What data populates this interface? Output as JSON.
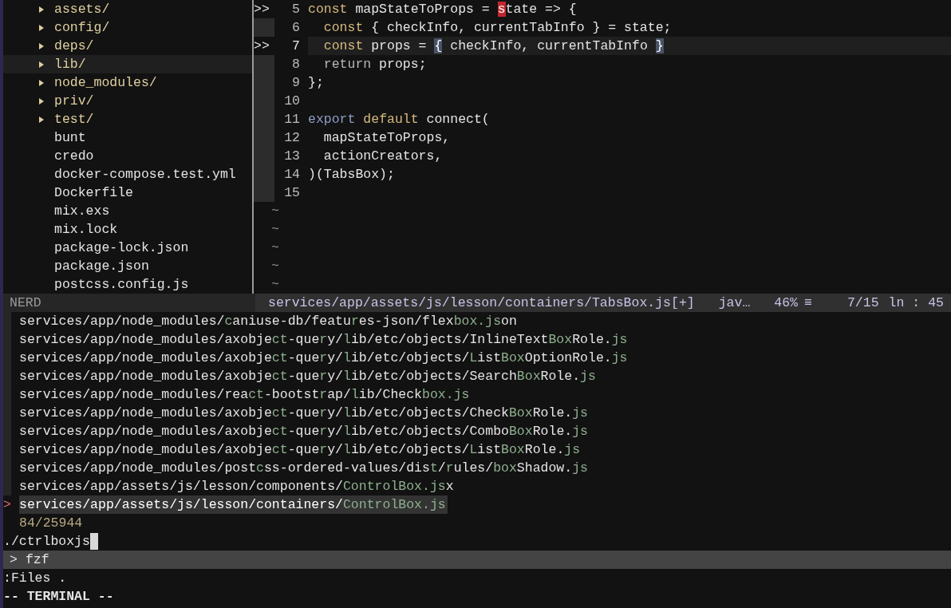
{
  "tree": {
    "items": [
      {
        "name": "assets/",
        "kind": "dir",
        "selected": false
      },
      {
        "name": "config/",
        "kind": "dir",
        "selected": false
      },
      {
        "name": "deps/",
        "kind": "dir",
        "selected": false
      },
      {
        "name": "lib/",
        "kind": "dir",
        "selected": true
      },
      {
        "name": "node_modules/",
        "kind": "dir",
        "selected": false
      },
      {
        "name": "priv/",
        "kind": "dir",
        "selected": false
      },
      {
        "name": "test/",
        "kind": "dir",
        "selected": false
      },
      {
        "name": "bunt",
        "kind": "file",
        "selected": false
      },
      {
        "name": "credo",
        "kind": "file",
        "selected": false
      },
      {
        "name": "docker-compose.test.yml",
        "kind": "file",
        "selected": false
      },
      {
        "name": "Dockerfile",
        "kind": "file",
        "selected": false
      },
      {
        "name": "mix.exs",
        "kind": "file",
        "selected": false
      },
      {
        "name": "mix.lock",
        "kind": "file",
        "selected": false
      },
      {
        "name": "package-lock.json",
        "kind": "file",
        "selected": false
      },
      {
        "name": "package.json",
        "kind": "file",
        "selected": false
      },
      {
        "name": "postcss.config.js",
        "kind": "file",
        "selected": false
      }
    ]
  },
  "editor": {
    "lines": [
      {
        "number": "5",
        "sign": ">>",
        "current": false,
        "tokens": [
          {
            "text": "const",
            "kind": "keyword"
          },
          {
            "text": " mapStateToProps = ",
            "kind": "plain"
          },
          {
            "text": "s",
            "kind": "cursor"
          },
          {
            "text": "tate => {",
            "kind": "plain"
          }
        ]
      },
      {
        "number": "6",
        "current": false,
        "tokens": [
          {
            "text": "  const",
            "kind": "keyword"
          },
          {
            "text": " { checkInfo, currentTabInfo } = state;",
            "kind": "plain"
          }
        ]
      },
      {
        "number": "7",
        "sign": ">>",
        "current": true,
        "tokens": [
          {
            "text": "  const",
            "kind": "keyword"
          },
          {
            "text": " props = ",
            "kind": "plain"
          },
          {
            "text": "{",
            "kind": "match"
          },
          {
            "text": " checkInfo, currentTabInfo ",
            "kind": "plain"
          },
          {
            "text": "}",
            "kind": "match"
          }
        ]
      },
      {
        "number": "8",
        "current": false,
        "tokens": [
          {
            "text": "  return",
            "kind": "return"
          },
          {
            "text": " props;",
            "kind": "plain"
          }
        ]
      },
      {
        "number": "9",
        "current": false,
        "tokens": [
          {
            "text": "};",
            "kind": "plain"
          }
        ]
      },
      {
        "number": "10",
        "current": false
      },
      {
        "number": "11",
        "current": false,
        "tokens": [
          {
            "text": "export",
            "kind": "export"
          },
          {
            "text": " default",
            "kind": "keyword"
          },
          {
            "text": " connect(",
            "kind": "plain"
          }
        ]
      },
      {
        "number": "12",
        "current": false,
        "tokens": [
          {
            "text": "  mapStateToProps,",
            "kind": "plain"
          }
        ]
      },
      {
        "number": "13",
        "current": false,
        "tokens": [
          {
            "text": "  actionCreators,",
            "kind": "plain"
          }
        ]
      },
      {
        "number": "14",
        "current": false,
        "tokens": [
          {
            "text": ")(TabsBox);",
            "kind": "plain"
          }
        ]
      },
      {
        "number": "15",
        "current": false
      }
    ],
    "empty_lines": [
      "~",
      "~",
      "~",
      "~",
      "~"
    ]
  },
  "status_bar": {
    "mode": "NERD",
    "file": "services/app/assets/js/lesson/containers/TabsBox.js[+]",
    "filetype": "jav…",
    "percent": "46%",
    "menu": "≡",
    "position": "7/15",
    "line_label": "ln",
    "column": ": 45"
  },
  "fzf": {
    "pointer": ">",
    "results": [
      {
        "selected": false,
        "segments": [
          "services/app/node_modules/",
          "c",
          "aniuse-db/featu",
          "r",
          "es-json/flex",
          "box.js",
          "on"
        ]
      },
      {
        "selected": false,
        "segments": [
          "services/app/node_modules/axobje",
          "ct",
          "-que",
          "r",
          "y/",
          "l",
          "ib/etc/objects/InlineText",
          "Box",
          "Role.",
          "js"
        ]
      },
      {
        "selected": false,
        "segments": [
          "services/app/node_modules/axobje",
          "ct",
          "-que",
          "r",
          "y/",
          "l",
          "ib/etc/objects/",
          "L",
          "ist",
          "Box",
          "OptionRole.",
          "js"
        ]
      },
      {
        "selected": false,
        "segments": [
          "services/app/node_modules/axobje",
          "ct",
          "-que",
          "r",
          "y/",
          "l",
          "ib/etc/objects/Search",
          "Box",
          "Role.",
          "js"
        ]
      },
      {
        "selected": false,
        "segments": [
          "services/app/node_modules/rea",
          "ct",
          "-bootst",
          "r",
          "ap/",
          "l",
          "ib/Check",
          "box.js"
        ]
      },
      {
        "selected": false,
        "segments": [
          "services/app/node_modules/axobje",
          "ct",
          "-que",
          "r",
          "y/",
          "l",
          "ib/etc/objects/Check",
          "Box",
          "Role.",
          "js"
        ]
      },
      {
        "selected": false,
        "segments": [
          "services/app/node_modules/axobje",
          "ct",
          "-que",
          "r",
          "y/",
          "l",
          "ib/etc/objects/Combo",
          "Box",
          "Role.",
          "js"
        ]
      },
      {
        "selected": false,
        "segments": [
          "services/app/node_modules/axobje",
          "ct",
          "-que",
          "r",
          "y/",
          "l",
          "ib/etc/objects/",
          "L",
          "ist",
          "Box",
          "Role.",
          "js"
        ]
      },
      {
        "selected": false,
        "segments": [
          "services/app/node_modules/post",
          "c",
          "ss-ordered-values/dis",
          "t",
          "/",
          "r",
          "ules/",
          "box",
          "Shadow.",
          "js"
        ]
      },
      {
        "selected": false,
        "segments": [
          "services/app/assets/js/lesson/components/",
          "ControlBox.js",
          "x"
        ]
      },
      {
        "selected": true,
        "segments": [
          "services/app/assets/js/lesson/containers/",
          "ControlBox.js"
        ]
      }
    ],
    "count": "84/25944",
    "query": "./ctrlboxjs",
    "prompt_marker": ">",
    "prompt_label": "fzf"
  },
  "command_line": ":Files .",
  "mode_line": "-- TERMINAL --"
}
